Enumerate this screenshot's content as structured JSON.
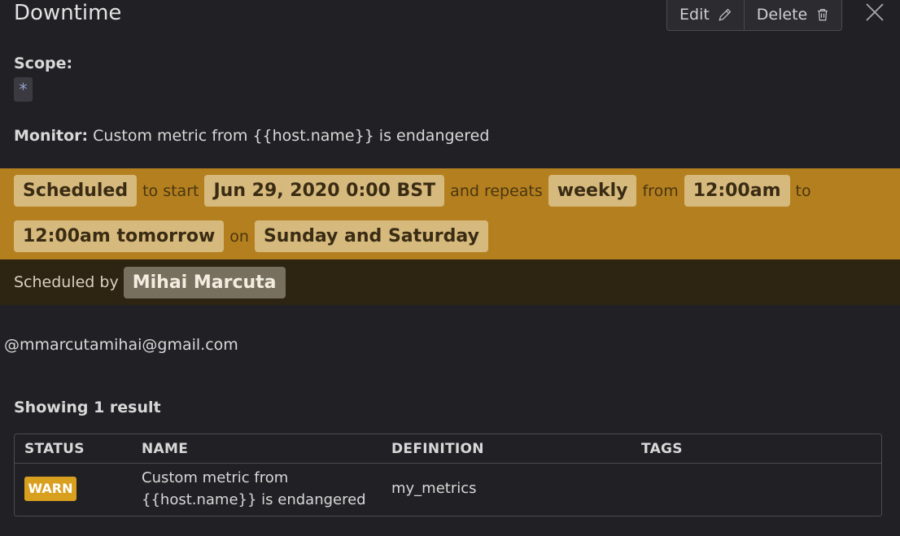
{
  "header": {
    "title": "Downtime",
    "edit_label": "Edit",
    "delete_label": "Delete"
  },
  "scope": {
    "label": "Scope:",
    "value": "*"
  },
  "monitor": {
    "label": "Monitor:",
    "value": "Custom metric from {{host.name}} is endangered"
  },
  "schedule": {
    "status": "Scheduled",
    "to_start": "to start",
    "start_date": "Jun 29, 2020 0:00 BST",
    "and_repeats": "and repeats",
    "frequency": "weekly",
    "from": "from",
    "from_time": "12:00am",
    "to": "to",
    "to_time": "12:00am tomorrow",
    "on": "on",
    "days": "Sunday and Saturday",
    "background_color": "#b4801f"
  },
  "scheduled_by": {
    "label": "Scheduled by",
    "name": "Mihai Marcuta"
  },
  "message": "@mmarcutamihai@gmail.com",
  "results": {
    "summary": "Showing 1 result",
    "columns": [
      "STATUS",
      "NAME",
      "DEFINITION",
      "TAGS"
    ],
    "rows": [
      {
        "status": "WARN",
        "status_color": "#d9a020",
        "name_line1": "Custom metric from",
        "name_line2": "{{host.name}} is endangered",
        "definition": "my_metrics",
        "tags": ""
      }
    ]
  },
  "icons": {
    "edit": "pencil-icon",
    "delete": "trash-icon",
    "close": "close-icon"
  }
}
